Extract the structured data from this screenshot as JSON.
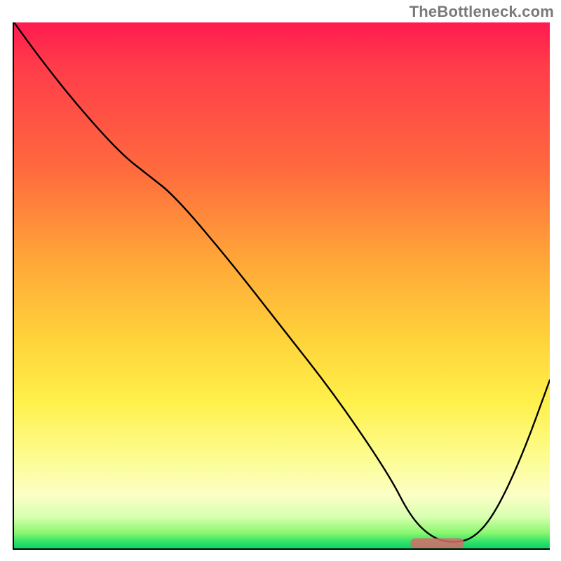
{
  "watermark": "TheBottleneck.com",
  "chart_data": {
    "type": "line",
    "title": "",
    "xlabel": "",
    "ylabel": "",
    "xlim": [
      0,
      100
    ],
    "ylim": [
      0,
      100
    ],
    "series": [
      {
        "name": "bottleneck-curve",
        "x": [
          0,
          5,
          12,
          20,
          25,
          30,
          40,
          50,
          60,
          70,
          74,
          78,
          82,
          86,
          90,
          95,
          100
        ],
        "values": [
          100,
          93,
          84,
          75,
          71,
          67,
          55,
          42,
          29,
          14,
          6,
          2,
          1,
          2,
          7,
          18,
          32
        ]
      }
    ],
    "optimal_marker": {
      "x_start": 74,
      "x_end": 84,
      "y": 1
    },
    "grid": false,
    "legend": false
  }
}
